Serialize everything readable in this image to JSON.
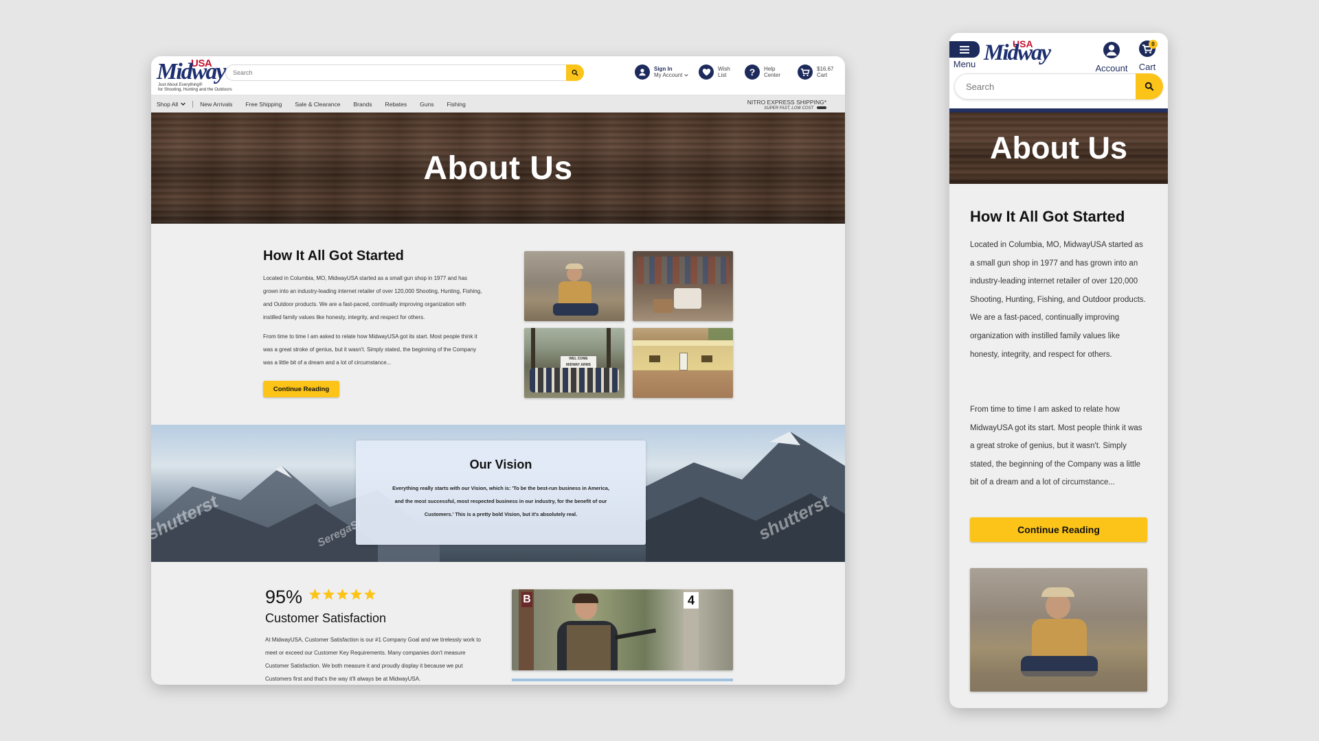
{
  "desktop": {
    "logo": {
      "usa": "USA",
      "brand": "Midway",
      "tagline_1": "Just About Everything®",
      "tagline_2": "for Shooting, Hunting and the Outdoors"
    },
    "search": {
      "placeholder": "Search"
    },
    "header": {
      "account": {
        "line1": "Sign In",
        "line2": "My Account"
      },
      "wishlist": {
        "line1": "Wish",
        "line2": "List"
      },
      "help": {
        "line1": "Help",
        "line2": "Center"
      },
      "cart": {
        "line1": "$16.67",
        "line2": "Cart"
      }
    },
    "nav": {
      "shop_all": "Shop All",
      "items": [
        "New Arrivals",
        "Free Shipping",
        "Sale & Clearance",
        "Brands",
        "Rebates",
        "Guns",
        "Fishing"
      ],
      "promo_line1": "NITRO EXPRESS SHIPPING*",
      "promo_line2": "SUPER FAST, LOW COST"
    },
    "hero_title": "About Us",
    "story": {
      "title": "How It All Got Started",
      "para1": "Located in Columbia, MO, MidwayUSA started as a small gun shop in 1977 and has grown into an industry-leading internet retailer of over 120,000 Shooting, Hunting, Fishing, and Outdoor products. We are a fast-paced, continually improving organization with instilled family values like honesty, integrity, and respect for others.",
      "para2": "From time to time I am asked to relate how MidwayUSA got its start. Most people think it was a great stroke of genius, but it wasn't. Simply stated, the beginning of the Company was a little bit of a dream and a lot of circumstance...",
      "button": "Continue Reading",
      "sign_text_1": "WEL COME",
      "sign_text_2": "MIDWAY ARMS"
    },
    "vision": {
      "title": "Our Vision",
      "text": "Everything really starts with our Vision, which is: 'To be the best-run business in America, and the most successful, most respected business in our industry, for the benefit of our Customers.' This is a pretty bold Vision, but it's absolutely real.",
      "watermark_1": "shutterst",
      "watermark_2": "SeregaSi",
      "watermark_3": "shutterst"
    },
    "satisfaction": {
      "percent": "95%",
      "rating": 5,
      "title": "Customer Satisfaction",
      "text": "At MidwayUSA, Customer Satisfaction is our #1 Company Goal and we tirelessly work to meet or exceed our Customer Key Requirements. Many companies don't measure Customer Satisfaction. We both measure it and proudly display it because we put Customers first and that's the way it'll always be at MidwayUSA.",
      "post_label_1": "B",
      "post_label_2": "4"
    }
  },
  "mobile": {
    "menu_label": "Menu",
    "logo": {
      "usa": "USA",
      "brand": "Midway"
    },
    "account_label": "Account",
    "cart_label": "Cart",
    "cart_count": "0",
    "search": {
      "placeholder": "Search"
    },
    "hero_title": "About Us",
    "story": {
      "title": "How It All Got Started",
      "para1": "Located in Columbia, MO, MidwayUSA started as a small gun shop in 1977 and has grown into an industry-leading internet retailer of over 120,000 Shooting, Hunting, Fishing, and Outdoor products. We are a fast-paced, continually improving organization with instilled family values like honesty, integrity, and respect for others.",
      "para2": "From time to time I am asked to relate how MidwayUSA got its start. Most people think it was a great stroke of genius, but it wasn't. Simply stated, the beginning of the Company was a little bit of a dream and a lot of circumstance...",
      "button": "Continue Reading"
    }
  },
  "colors": {
    "brand_navy": "#1d2a5c",
    "brand_red": "#c8102e",
    "accent_yellow": "#fcc419"
  },
  "icons": [
    "search-icon",
    "user-icon",
    "heart-icon",
    "help-icon",
    "cart-icon",
    "chevron-down-icon",
    "menu-icon",
    "star-icon"
  ]
}
